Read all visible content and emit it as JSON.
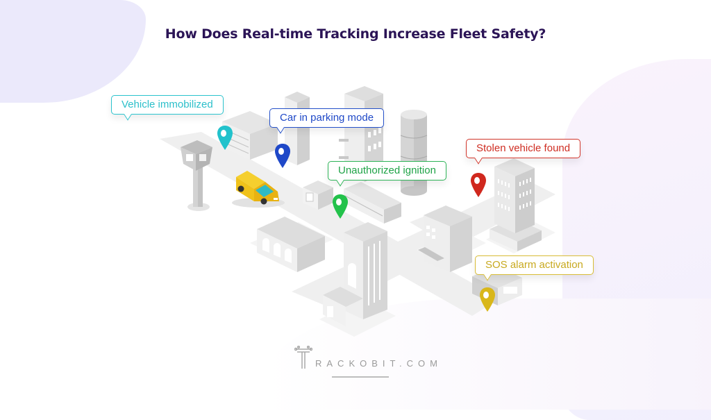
{
  "title": "How Does Real-time Tracking Increase Fleet Safety?",
  "callouts": {
    "immobilized": {
      "label": "Vehicle immobilized",
      "color": "#2bc3cd"
    },
    "parking": {
      "label": "Car in parking mode",
      "color": "#2450c9"
    },
    "ignition": {
      "label": "Unauthorized ignition",
      "color": "#2cb356"
    },
    "stolen": {
      "label": "Stolen vehicle found",
      "color": "#d1352a"
    },
    "sos": {
      "label": "SOS alarm activation",
      "color": "#d8bc35"
    }
  },
  "brand": {
    "name": "RACKOBIT.COM",
    "logo_icon": "circuit-t-icon",
    "title_color": "#2b1456"
  },
  "illustration": {
    "vehicle": "yellow-delivery-van",
    "pins": [
      "cyan-pin",
      "blue-pin",
      "green-pin",
      "red-pin",
      "yellow-pin"
    ]
  }
}
